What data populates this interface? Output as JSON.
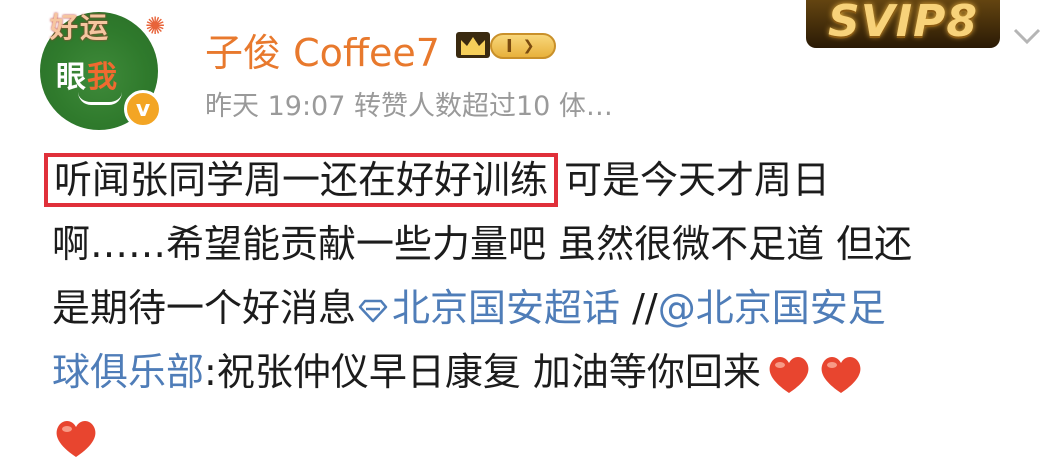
{
  "avatar": {
    "top_text": "好运",
    "main_text_1": "眼",
    "main_text_2": "我"
  },
  "header": {
    "username": "子俊 Coffee7",
    "level_badge": "I",
    "meta_line": "昨天 19:07 转赞人数超过10 体…",
    "svip_label": "SVIP8"
  },
  "post": {
    "highlighted_text": "听闻张同学周一还在好好训练",
    "line1_rest": "可是今天才周日",
    "line2": "啊……希望能贡献一些力量吧 虽然很微不足道 但还",
    "line3_start": "是期待一个好消息",
    "topic": "北京国安超话",
    "repost_sep": " //",
    "mention_part1": "@北京国安足",
    "mention_part2": "球俱乐部",
    "line4_rest": ":祝张仲仪早日康复 加油等你回来"
  },
  "colors": {
    "username": "#e8792d",
    "link": "#4f7db8",
    "highlight_border": "#e0303a",
    "heart": "#e8452f",
    "meta": "#9a9a9a"
  }
}
